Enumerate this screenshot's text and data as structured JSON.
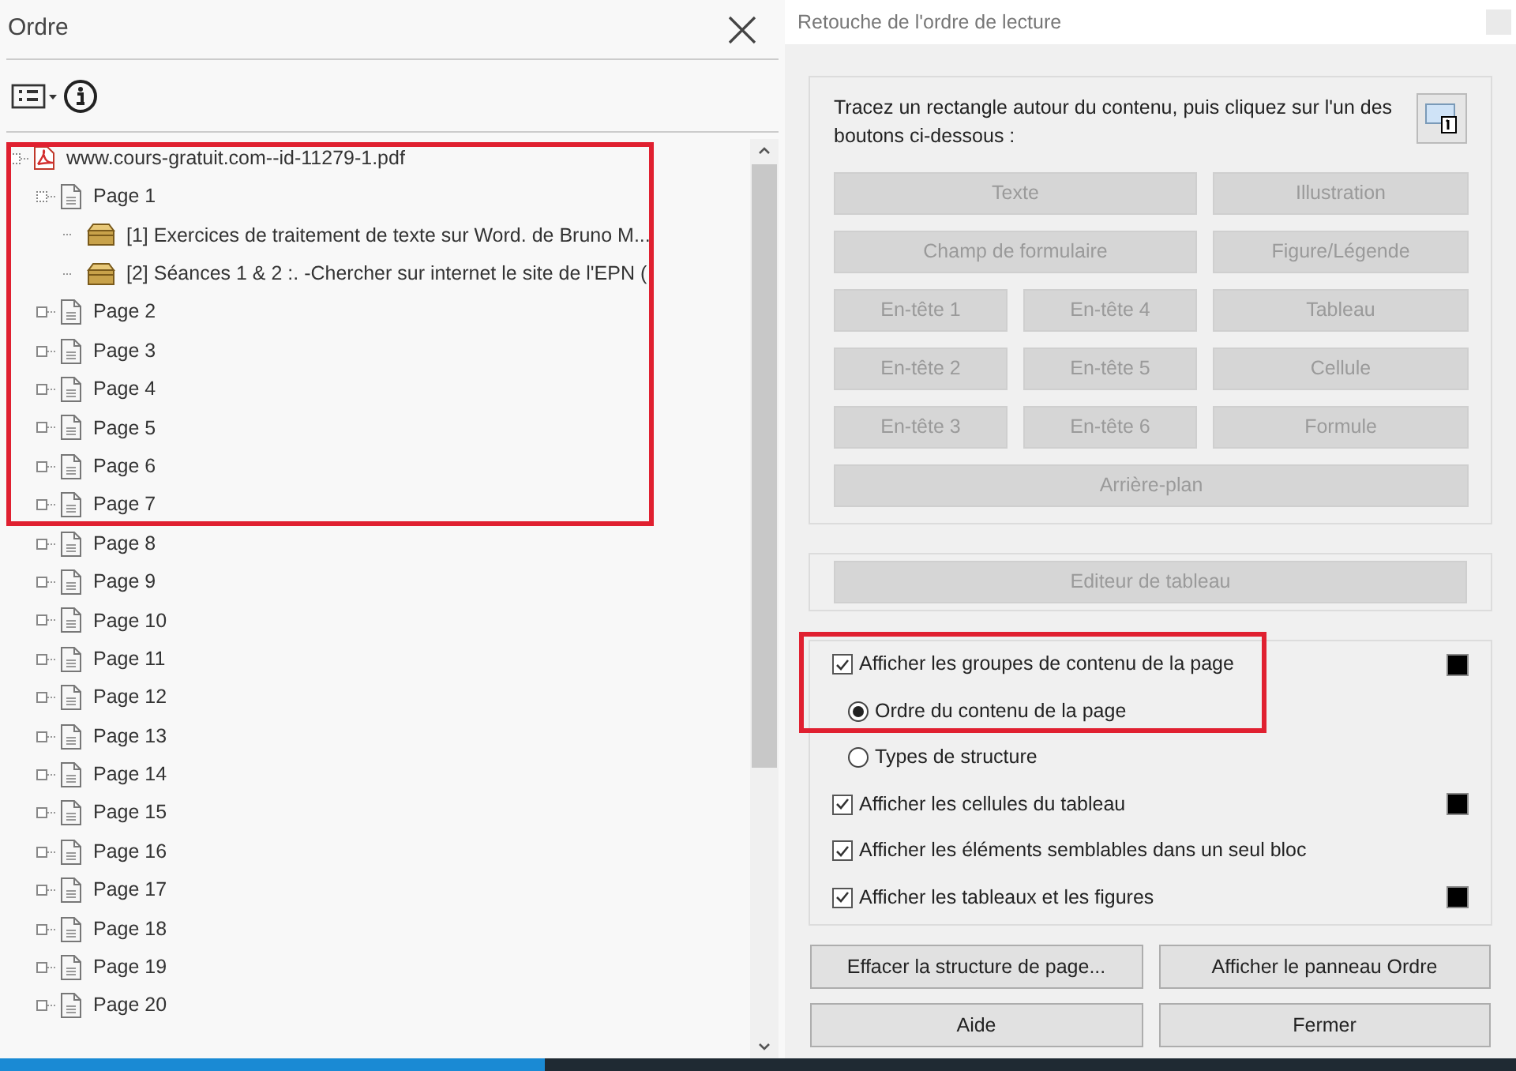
{
  "order_panel": {
    "title": "Ordre",
    "tree": {
      "label": "www.cours-gratuit.com--id-11279-1.pdf",
      "kind": "pdf",
      "expanded": true,
      "children": [
        {
          "label": "Page 1",
          "kind": "page",
          "expanded": true,
          "children": [
            {
              "label": "[1]  Exercices de traitement de texte sur Word. de Bruno M...",
              "kind": "content"
            },
            {
              "label": "[2]  Séances 1 & 2 :. -Chercher sur internet le site de l'EPN (",
              "kind": "content"
            }
          ]
        },
        {
          "label": "Page 2",
          "kind": "page",
          "expanded": false
        },
        {
          "label": "Page 3",
          "kind": "page",
          "expanded": false
        },
        {
          "label": "Page 4",
          "kind": "page",
          "expanded": false
        },
        {
          "label": "Page 5",
          "kind": "page",
          "expanded": false
        },
        {
          "label": "Page 6",
          "kind": "page",
          "expanded": false
        },
        {
          "label": "Page 7",
          "kind": "page",
          "expanded": false
        },
        {
          "label": "Page 8",
          "kind": "page",
          "expanded": false
        },
        {
          "label": "Page 9",
          "kind": "page",
          "expanded": false
        },
        {
          "label": "Page 10",
          "kind": "page",
          "expanded": false
        },
        {
          "label": "Page 11",
          "kind": "page",
          "expanded": false
        },
        {
          "label": "Page 12",
          "kind": "page",
          "expanded": false
        },
        {
          "label": "Page 13",
          "kind": "page",
          "expanded": false
        },
        {
          "label": "Page 14",
          "kind": "page",
          "expanded": false
        },
        {
          "label": "Page 15",
          "kind": "page",
          "expanded": false
        },
        {
          "label": "Page 16",
          "kind": "page",
          "expanded": false
        },
        {
          "label": "Page 17",
          "kind": "page",
          "expanded": false
        },
        {
          "label": "Page 18",
          "kind": "page",
          "expanded": false
        },
        {
          "label": "Page 19",
          "kind": "page",
          "expanded": false
        },
        {
          "label": "Page 20",
          "kind": "page",
          "expanded": false
        }
      ]
    }
  },
  "touchup_dialog": {
    "title": "Retouche de l'ordre de lecture",
    "instruction": "Tracez un rectangle autour du contenu, puis cliquez sur l'un des boutons ci-dessous :",
    "tool_button_rows": [
      [
        {
          "label": "Texte",
          "disabled": true
        },
        {
          "label": "Illustration",
          "disabled": true
        }
      ],
      [
        {
          "label": "Champ de formulaire",
          "disabled": true
        },
        {
          "label": "Figure/Légende",
          "disabled": true
        }
      ],
      [
        {
          "label": "En-tête 1",
          "disabled": true
        },
        {
          "label": "En-tête 4",
          "disabled": true
        },
        {
          "label": "Tableau",
          "disabled": true
        }
      ],
      [
        {
          "label": "En-tête 2",
          "disabled": true
        },
        {
          "label": "En-tête 5",
          "disabled": true
        },
        {
          "label": "Cellule",
          "disabled": true
        }
      ],
      [
        {
          "label": "En-tête 3",
          "disabled": true
        },
        {
          "label": "En-tête 6",
          "disabled": true
        },
        {
          "label": "Formule",
          "disabled": true
        }
      ],
      [
        {
          "label": "Arrière-plan",
          "disabled": true
        }
      ]
    ],
    "table_editor_button": {
      "label": "Editeur de tableau",
      "disabled": true
    },
    "options": [
      {
        "kind": "checkbox",
        "label": "Afficher les groupes de contenu de la page",
        "checked": true,
        "swatch": true
      },
      {
        "kind": "radio",
        "label": "Ordre du contenu de la page",
        "selected": true
      },
      {
        "kind": "radio",
        "label": "Types de structure",
        "selected": false
      },
      {
        "kind": "checkbox",
        "label": "Afficher les cellules du tableau",
        "checked": true,
        "swatch": true
      },
      {
        "kind": "checkbox",
        "label": "Afficher les éléments semblables dans un seul bloc",
        "checked": true,
        "swatch": false
      },
      {
        "kind": "checkbox",
        "label": "Afficher les tableaux et les figures",
        "checked": true,
        "swatch": true
      }
    ],
    "buttons": [
      "Effacer la structure de page...",
      "Afficher le panneau Ordre",
      "Aide",
      "Fermer"
    ]
  }
}
